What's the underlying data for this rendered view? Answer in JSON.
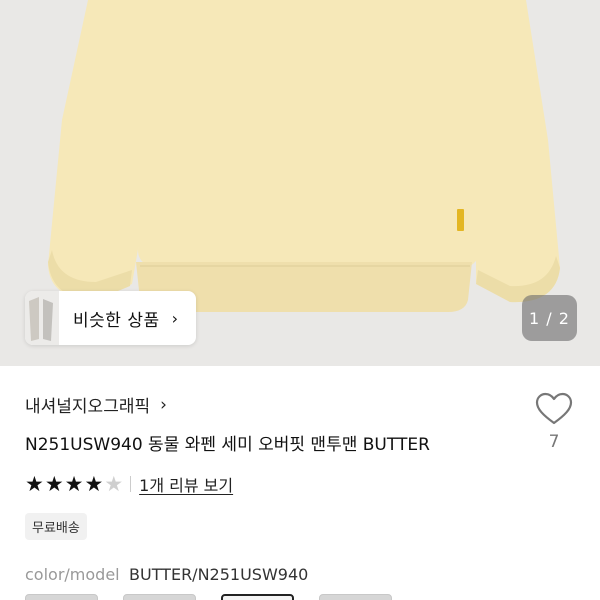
{
  "product_image": {
    "alt": "sweatshirt",
    "colors": {
      "background": "#e9e8e6",
      "garment": "#f6e8b8",
      "garment_shade": "#ecdda8",
      "tag": "#e3b623"
    }
  },
  "similar": {
    "label": "비슷한 상품",
    "chevron": "›"
  },
  "gallery": {
    "indicator": "1 / 2"
  },
  "brand": {
    "name": "내셔널지오그래픽",
    "chevron": "›"
  },
  "product": {
    "title": "N251USW940 동물 와펜 세미 오버핏 맨투맨 BUTTER"
  },
  "like": {
    "count": "7"
  },
  "rating": {
    "stars_filled": 4,
    "stars_total": 5,
    "review_link": "1개 리뷰 보기"
  },
  "badge": {
    "label": "무료배송"
  },
  "spec": {
    "key": "color/model",
    "value": "BUTTER/N251USW940"
  },
  "swatches": {
    "count": 4,
    "selected_index": 2
  }
}
